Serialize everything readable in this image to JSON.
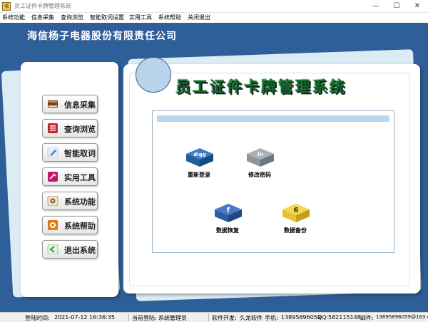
{
  "window": {
    "title": "员工证件卡牌管理系统",
    "app_icon_glyph": "卡",
    "minimize_glyph": "—",
    "maximize_glyph": "☐",
    "close_glyph": "✕"
  },
  "menu": [
    {
      "label": "系统功能"
    },
    {
      "label": "信息采集"
    },
    {
      "label": "查询浏览"
    },
    {
      "label": "智能取词设置"
    },
    {
      "label": "实用工具"
    },
    {
      "label": "系统帮助"
    },
    {
      "label": "关闭退出"
    }
  ],
  "header": {
    "company": "海信杨子电器股份有限责任公司",
    "system_title": "员工证件卡牌管理系统"
  },
  "sidebar": {
    "items": [
      {
        "label": "信息采集",
        "icon": "book-icon",
        "color": "#7a3b1e"
      },
      {
        "label": "查询浏览",
        "icon": "list-icon",
        "color": "#c8262e"
      },
      {
        "label": "智能取词",
        "icon": "pen-icon",
        "color": "#3a86c8"
      },
      {
        "label": "实用工具",
        "icon": "tools-icon",
        "color": "#c2186b"
      },
      {
        "label": "系统功能",
        "icon": "settings-icon",
        "color": "#8a5a2b"
      },
      {
        "label": "系统帮助",
        "icon": "help-icon",
        "color": "#e07a12"
      },
      {
        "label": "退出系统",
        "icon": "exit-icon",
        "color": "#3d9a3a"
      }
    ]
  },
  "tiles": [
    {
      "label": "重新登录",
      "icon": "digg-icon",
      "glyph": "digg",
      "color": "#1f5fa0"
    },
    {
      "label": "修改密码",
      "icon": "linkedin-icon",
      "glyph": "in",
      "color": "#8c949c"
    },
    {
      "label": "数据恢复",
      "icon": "facebook-icon",
      "glyph": "f",
      "color": "#2e5aa8"
    },
    {
      "label": "数据备份",
      "icon": "delicious-icon",
      "glyph": "6",
      "color": "#e8c22e"
    }
  ],
  "status": {
    "login_time_label": "登陆时间:",
    "login_time_value": "2021-07-12 16:36:35",
    "current_user_label": "当前登陆:",
    "current_user_value": "系统管理员",
    "developer_label": "软件开发:",
    "developer_value": "久龙软件",
    "phone_label": "手机:",
    "phone_value": "13895896059",
    "qq_label": "QQ:",
    "qq_value": "582115148",
    "email_label": "邮件:",
    "email_value": "13895896059@163.com"
  }
}
